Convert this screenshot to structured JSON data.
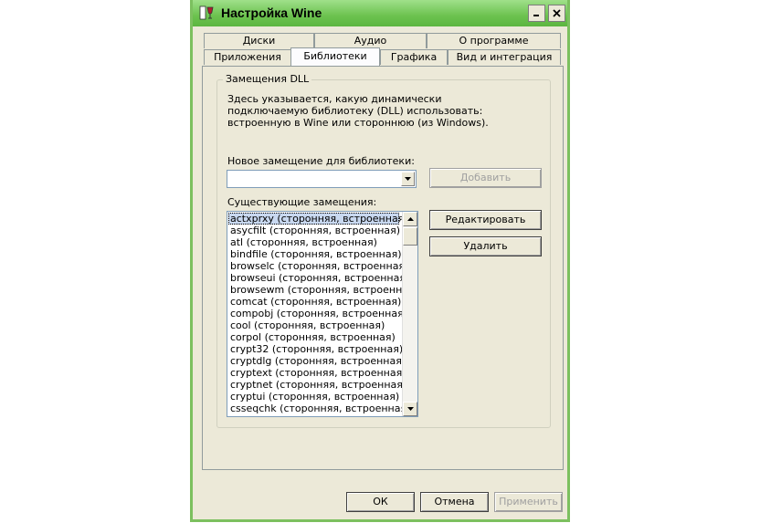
{
  "window": {
    "title": "Настройка Wine",
    "minimize_label": "_",
    "close_label": "✕"
  },
  "tabs": {
    "row1": [
      "Диски",
      "Аудио",
      "О программе"
    ],
    "row2": [
      "Приложения",
      "Библиотеки",
      "Графика",
      "Вид и интеграция"
    ],
    "active": "Библиотеки"
  },
  "panel": {
    "group_title": "Замещения DLL",
    "description": "Здесь указывается, какую динамически подключаемую библиотеку (DLL) использовать: встроенную в Wine или стороннюю (из Windows).",
    "new_override_label": "Новое замещение для библиотеки:",
    "new_override_value": "",
    "add_button": "Добавить",
    "existing_label": "Существующие замещения:",
    "edit_button": "Редактировать",
    "delete_button": "Удалить",
    "overrides": [
      "actxprxy (сторонняя, встроенная)",
      "asycfilt (сторонняя, встроенная)",
      "atl (сторонняя, встроенная)",
      "bindfile (сторонняя, встроенная)",
      "browselc (сторонняя, встроенная)",
      "browseui (сторонняя, встроенная)",
      "browsewm (сторонняя, встроенная)",
      "comcat (сторонняя, встроенная)",
      "compobj (сторонняя, встроенная)",
      "cool (сторонняя, встроенная)",
      "corpol (сторонняя, встроенная)",
      "crypt32 (сторонняя, встроенная)",
      "cryptdlg (сторонняя, встроенная)",
      "cryptext (сторонняя, встроенная)",
      "cryptnet (сторонняя, встроенная)",
      "cryptui (сторонняя, встроенная)",
      "csseqchk (сторонняя, встроенная)"
    ],
    "selected_index": 0
  },
  "footer": {
    "ok": "ОК",
    "cancel": "Отмена",
    "apply": "Применить"
  },
  "colors": {
    "titlebar": "#6cc24f",
    "window_bg": "#ece9d8",
    "selection": "#c8d8f0"
  }
}
